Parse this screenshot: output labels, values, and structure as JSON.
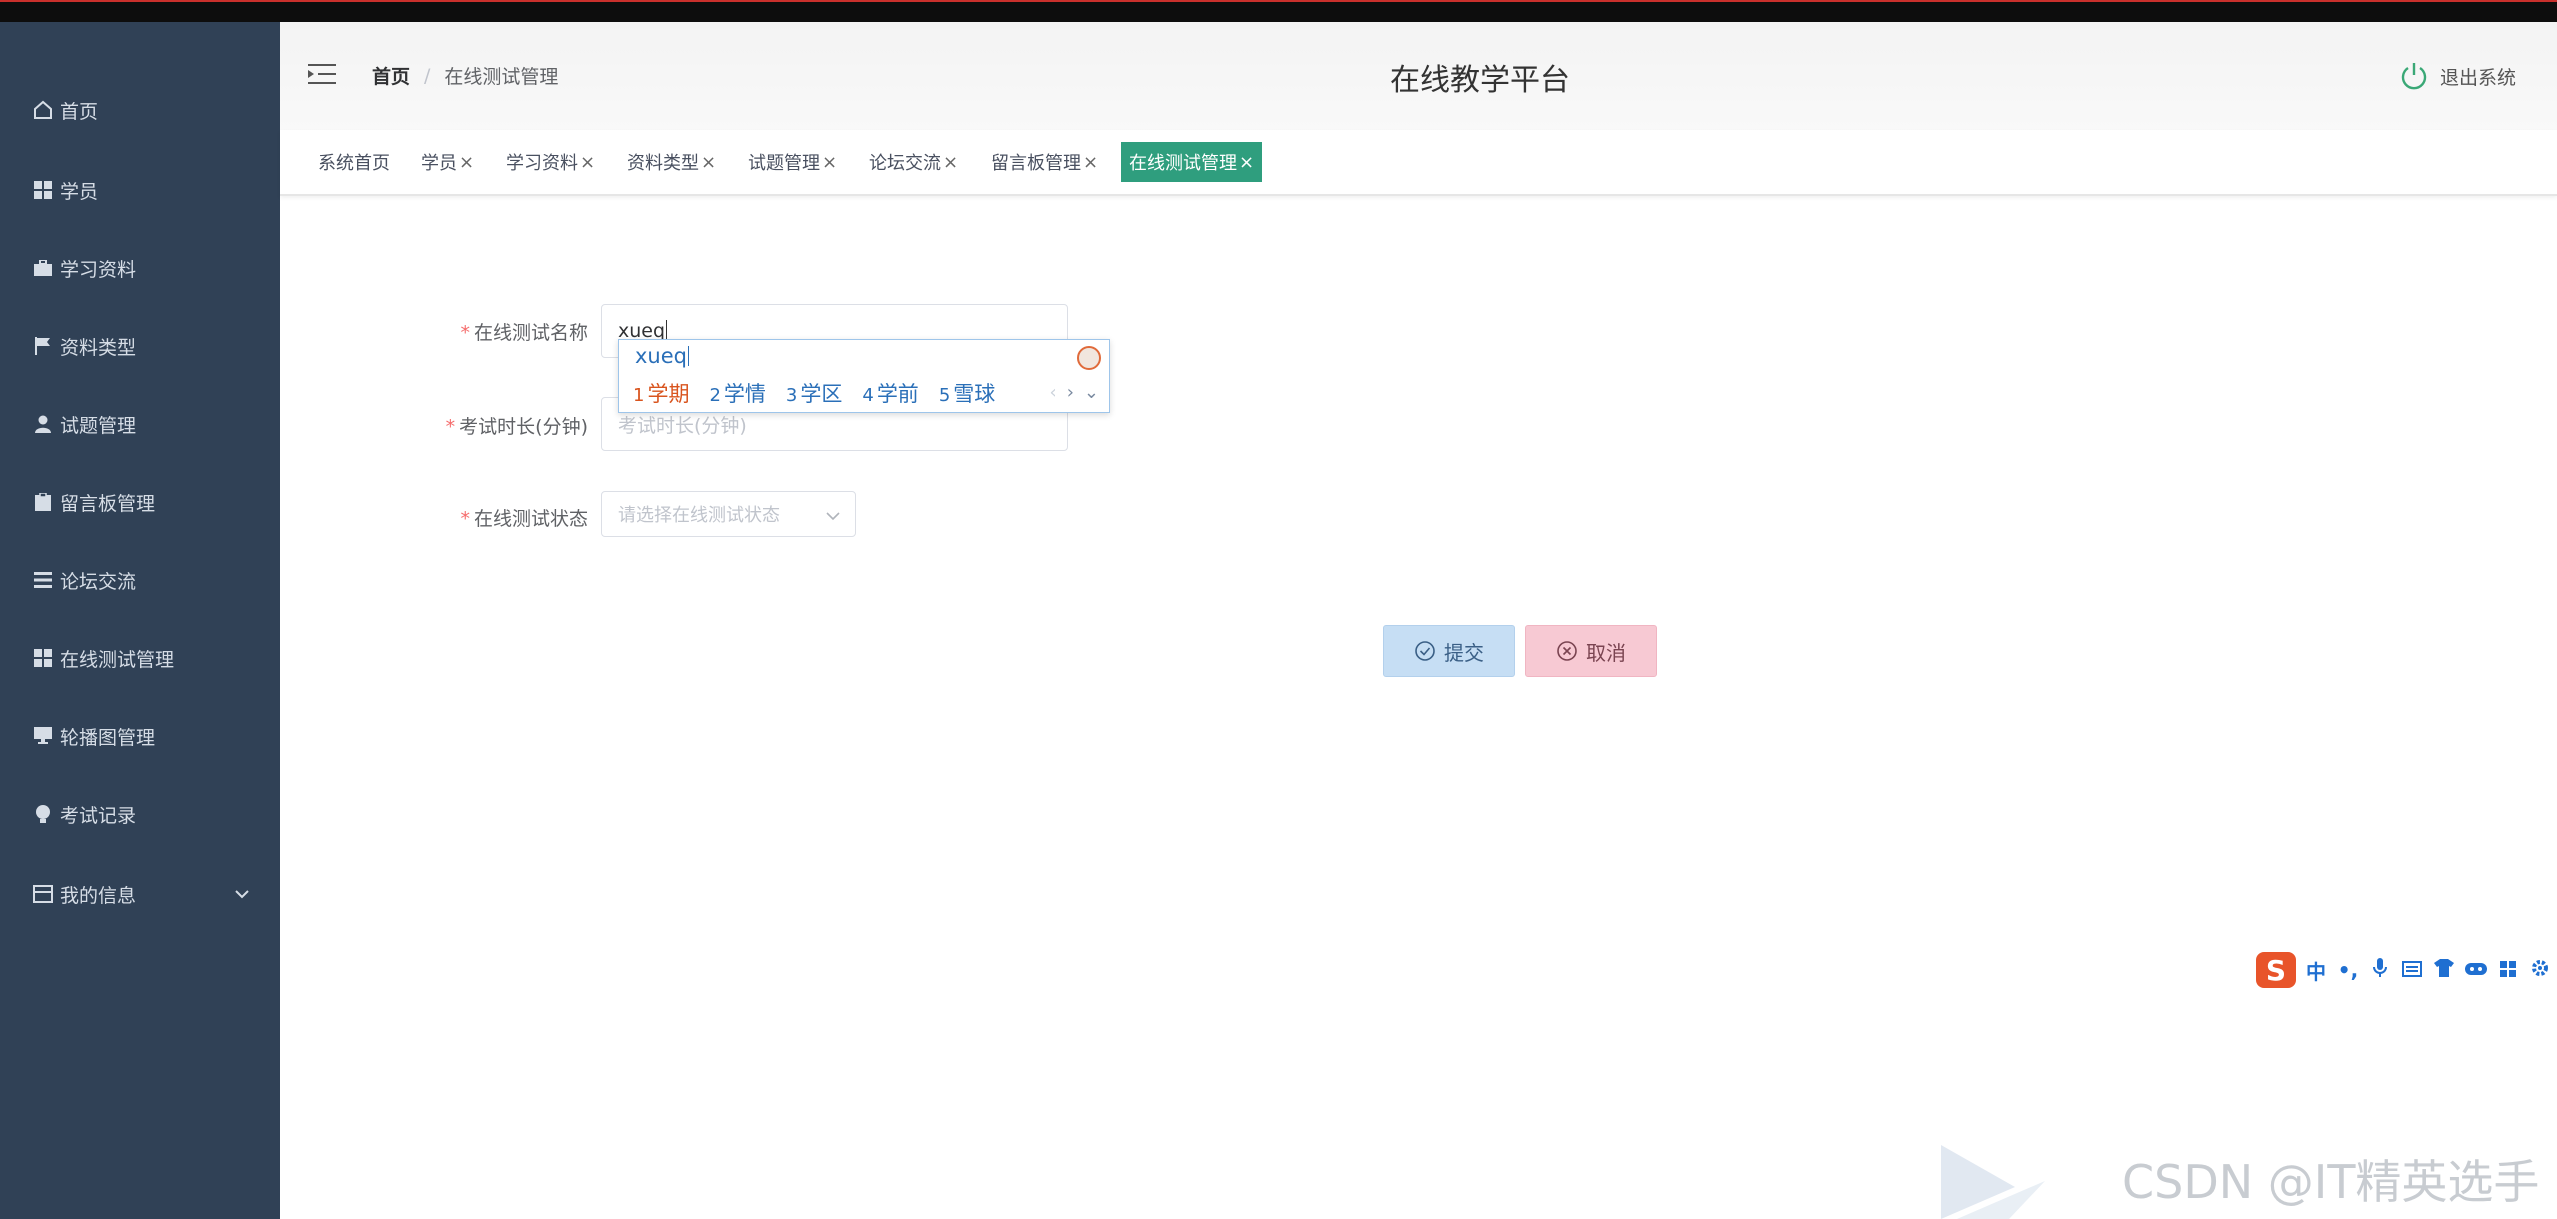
{
  "app": {
    "title": "在线教学平台",
    "logout_label": "退出系统"
  },
  "breadcrumb": {
    "home": "首页",
    "separator": "/",
    "current": "在线测试管理"
  },
  "sidebar": {
    "items": [
      {
        "label": "首页",
        "icon": "home-icon"
      },
      {
        "label": "学员",
        "icon": "grid-icon"
      },
      {
        "label": "学习资料",
        "icon": "briefcase-icon"
      },
      {
        "label": "资料类型",
        "icon": "flag-icon"
      },
      {
        "label": "试题管理",
        "icon": "user-icon"
      },
      {
        "label": "留言板管理",
        "icon": "clipboard-icon"
      },
      {
        "label": "论坛交流",
        "icon": "list-icon"
      },
      {
        "label": "在线测试管理",
        "icon": "grid-icon"
      },
      {
        "label": "轮播图管理",
        "icon": "monitor-icon"
      },
      {
        "label": "考试记录",
        "icon": "bulb-icon"
      },
      {
        "label": "我的信息",
        "icon": "card-icon"
      }
    ]
  },
  "tabs": [
    {
      "label": "系统首页",
      "closable": false,
      "active": false
    },
    {
      "label": "学员",
      "closable": true,
      "active": false
    },
    {
      "label": "学习资料",
      "closable": true,
      "active": false
    },
    {
      "label": "资料类型",
      "closable": true,
      "active": false
    },
    {
      "label": "试题管理",
      "closable": true,
      "active": false
    },
    {
      "label": "论坛交流",
      "closable": true,
      "active": false
    },
    {
      "label": "留言板管理",
      "closable": true,
      "active": false
    },
    {
      "label": "在线测试管理",
      "closable": true,
      "active": true
    }
  ],
  "tab_close_glyph": "×",
  "form": {
    "name": {
      "label": "在线测试名称",
      "value": "xueq"
    },
    "duration": {
      "label": "考试时长(分钟)",
      "placeholder": "考试时长(分钟)"
    },
    "status": {
      "label": "在线测试状态",
      "placeholder": "请选择在线测试状态"
    },
    "required_mark": "*"
  },
  "ime": {
    "composition": "xueq",
    "candidates": [
      {
        "num": "1",
        "text": "学期"
      },
      {
        "num": "2",
        "text": "学情"
      },
      {
        "num": "3",
        "text": "学区"
      },
      {
        "num": "4",
        "text": "学前"
      },
      {
        "num": "5",
        "text": "雪球"
      }
    ],
    "nav": {
      "prev": "‹",
      "next": "›",
      "more": "⌄"
    }
  },
  "buttons": {
    "submit": "提交",
    "cancel": "取消"
  },
  "imebar": {
    "logo": "S",
    "lang": "中",
    "punct": "•,"
  },
  "watermark": "CSDN @IT精英选手",
  "colors": {
    "sidebar_bg": "#304156",
    "active_tab": "#2f9e7e",
    "submit_bg": "#c6def4",
    "cancel_bg": "#f7c9d3"
  }
}
